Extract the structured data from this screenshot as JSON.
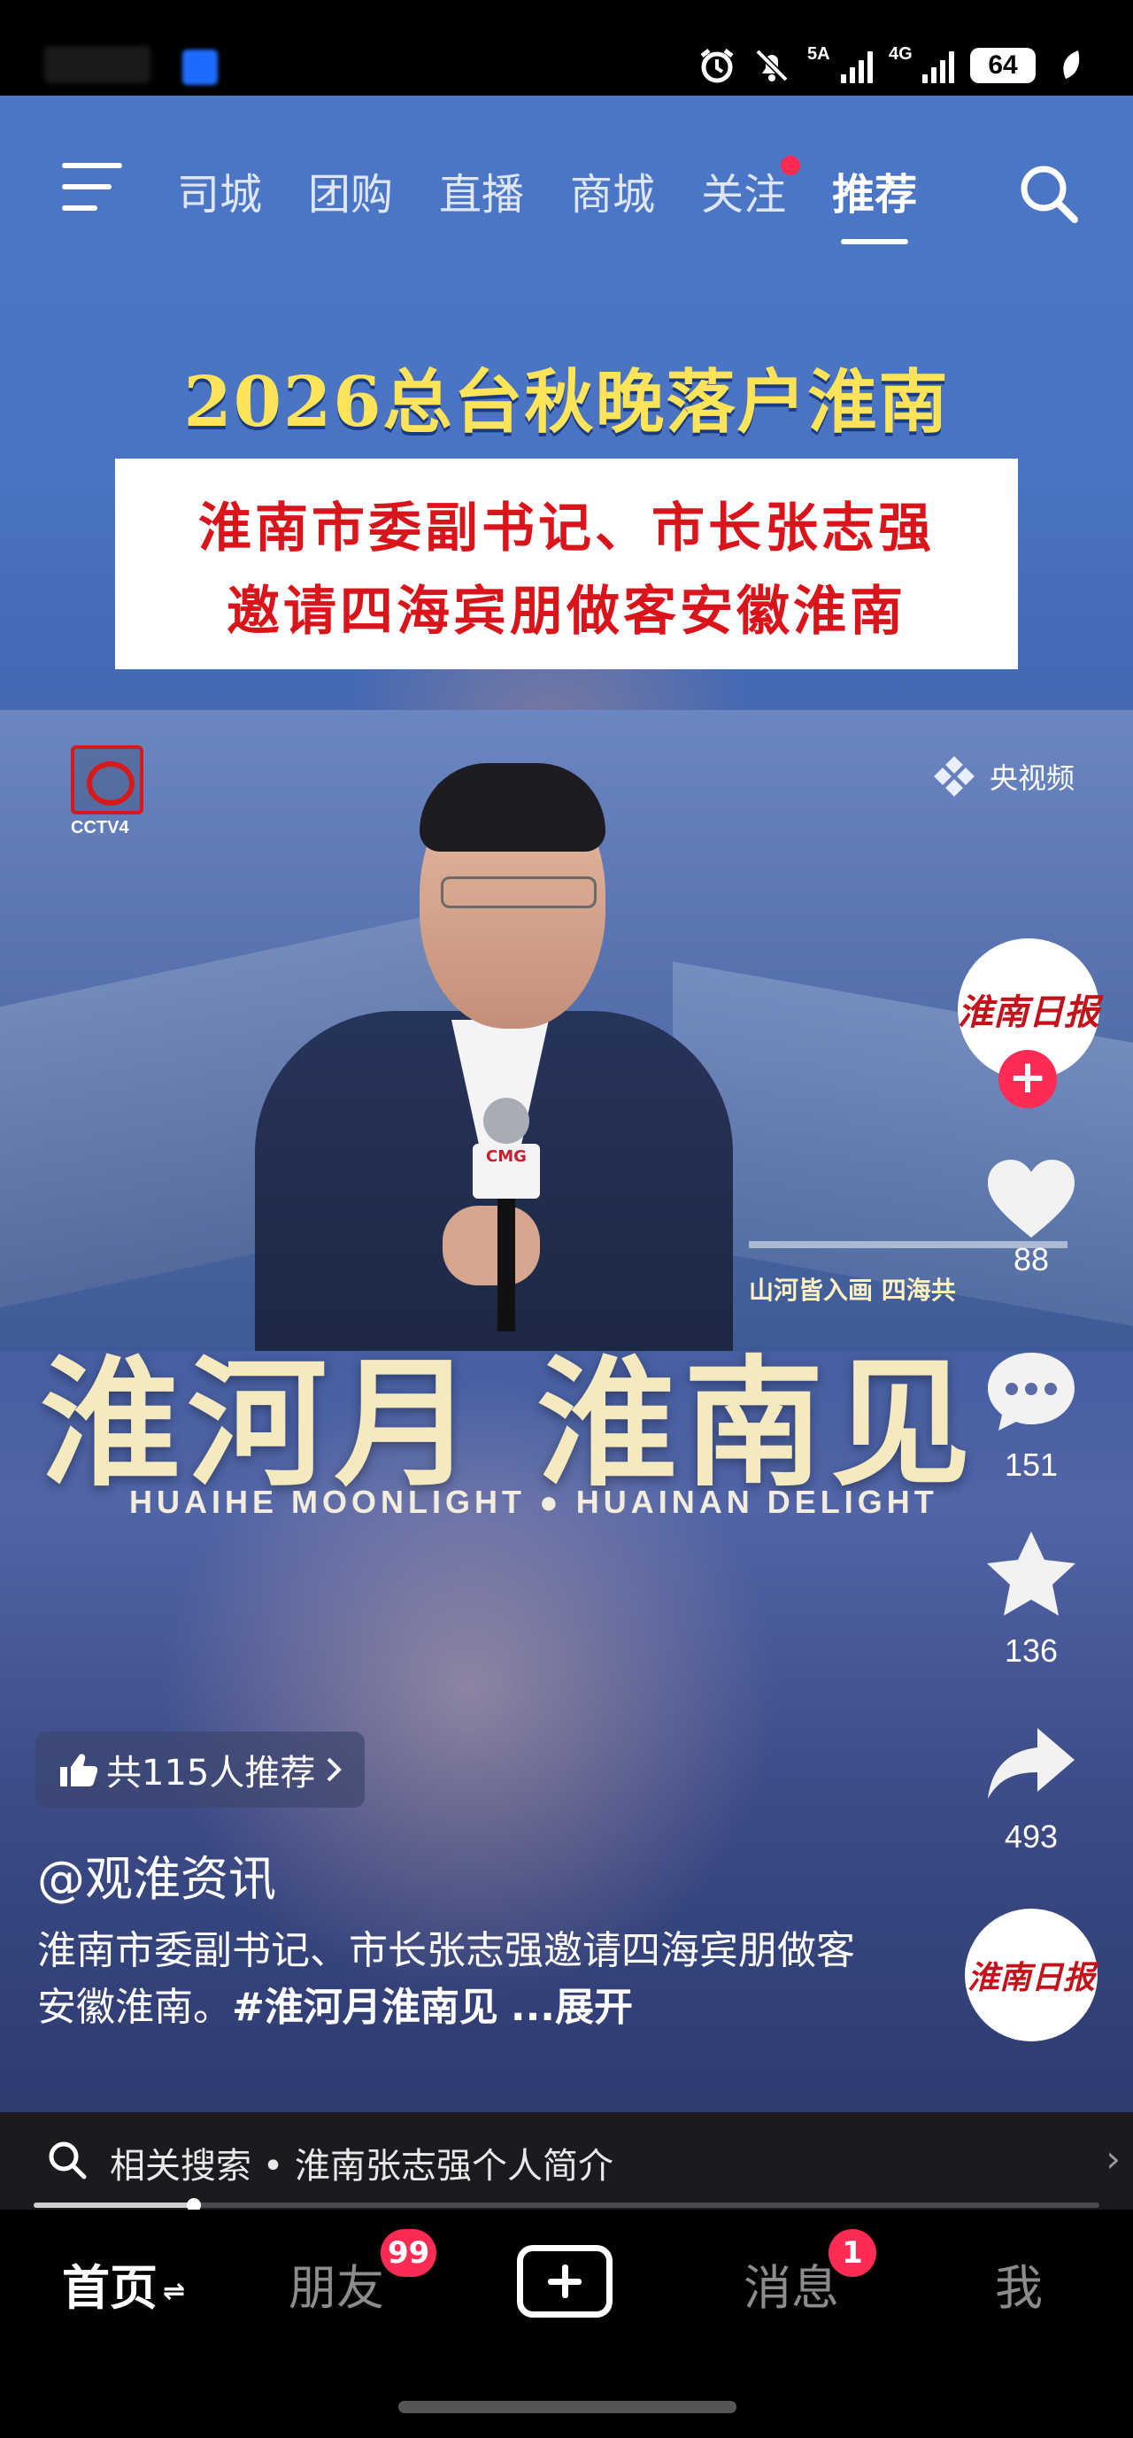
{
  "status_bar": {
    "network_1": "5A",
    "network_2": "4G",
    "battery": "64"
  },
  "top_nav": {
    "tabs": [
      "同城",
      "团购",
      "直播",
      "商城",
      "关注",
      "推荐"
    ],
    "tab_partial": "司城",
    "active_tab": "推荐"
  },
  "video": {
    "headline": "2026总台秋晚落户淮南",
    "box_line1": "淮南市委副书记、市长张志强",
    "box_line2": "邀请四海宾朋做客安徽淮南",
    "channel_logo": "CCTV4",
    "watermark": "央视频",
    "mic_label": "CMG",
    "lower_third": "山河皆入画 四海共",
    "slogan": "淮河月  淮南见",
    "slogan_en": "HUAIHE MOONLIGHT ● HUAINAN DELIGHT"
  },
  "actions": {
    "avatar_text": "淮南日报",
    "likes": "88",
    "comments": "151",
    "favorites": "136",
    "shares": "493"
  },
  "recommend_pill": "共115人推荐",
  "author": "@观淮资讯",
  "description": {
    "text": "淮南市委副书记、市长张志强邀请四海宾朋做客安徽淮南。",
    "hashtag": "#淮河月淮南见",
    "more": "...展开"
  },
  "related_search": {
    "label": "相关搜索 • 淮南张志强个人简介"
  },
  "progress": {
    "fraction": 0.15
  },
  "bottom_nav": {
    "home": "首页",
    "friends": "朋友",
    "friends_badge": "99",
    "messages": "消息",
    "messages_badge": "1",
    "me": "我"
  },
  "colors": {
    "accent": "#fe2c55",
    "headline": "#ffe45a",
    "box_text": "#d9141b"
  }
}
